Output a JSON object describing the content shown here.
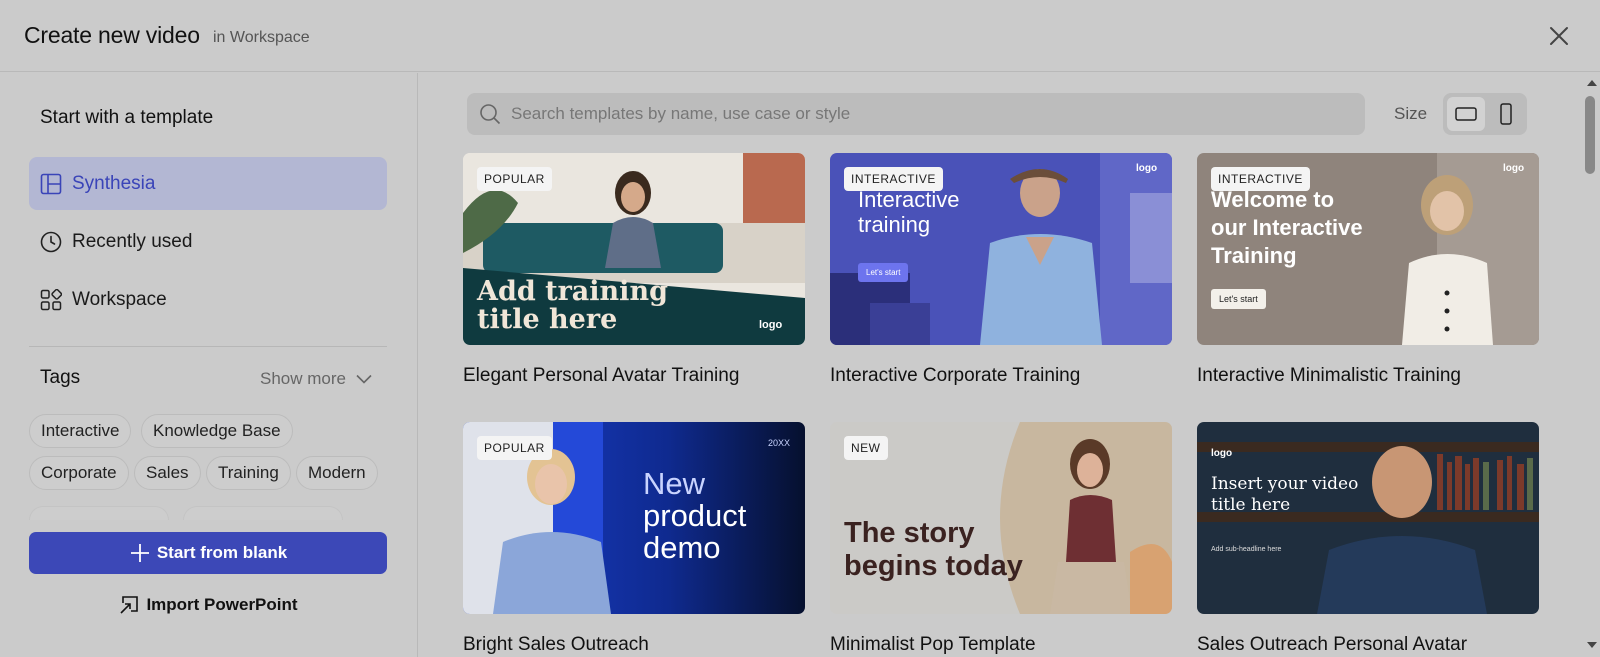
{
  "header": {
    "title": "Create new video",
    "subtitle": "in Workspace"
  },
  "sidebar": {
    "heading": "Start with a template",
    "items": [
      {
        "label": "Synthesia",
        "icon": "layout-icon",
        "active": true
      },
      {
        "label": "Recently used",
        "icon": "clock-icon",
        "active": false
      },
      {
        "label": "Workspace",
        "icon": "grid-icon",
        "active": false
      }
    ],
    "tags_label": "Tags",
    "show_more": "Show more",
    "tags": [
      "Interactive",
      "Knowledge Base",
      "Corporate",
      "Sales",
      "Training",
      "Modern"
    ],
    "start_blank": "Start from blank",
    "import_ppt": "Import PowerPoint"
  },
  "main": {
    "search_placeholder": "Search templates by name, use case or style",
    "size_label": "Size",
    "templates": [
      {
        "title": "Elegant Personal Avatar Training",
        "badge": "POPULAR",
        "thumb_text": "Add training title here",
        "thumb_line1": "Add training",
        "thumb_line2": "title here",
        "logo": "logo"
      },
      {
        "title": "Interactive Corporate Training",
        "badge": "INTERACTIVE",
        "thumb_line1": "Interactive",
        "thumb_line2": "training",
        "cta": "Let's start",
        "logo": "logo"
      },
      {
        "title": "Interactive Minimalistic Training",
        "badge": "INTERACTIVE",
        "thumb_line1": "Welcome to",
        "thumb_line2": "our Interactive",
        "thumb_line3": "Training",
        "cta": "Let's start",
        "logo": "logo"
      },
      {
        "title": "Bright Sales Outreach",
        "badge": "POPULAR",
        "thumb_line1": "New",
        "thumb_line2": "product",
        "thumb_line3": "demo",
        "year": "20XX"
      },
      {
        "title": "Minimalist Pop Template",
        "badge": "NEW",
        "thumb_line1": "The story",
        "thumb_line2": "begins today"
      },
      {
        "title": "Sales Outreach Personal Avatar",
        "logo": "logo",
        "thumb_line1": "Insert your video",
        "thumb_line2": "title here",
        "thumb_sub": "Add sub-headline here"
      }
    ]
  },
  "colors": {
    "accent": "#3c48b7",
    "active_nav_bg": "#b3b7d3",
    "overlay_bg": "#cbcbcb"
  }
}
